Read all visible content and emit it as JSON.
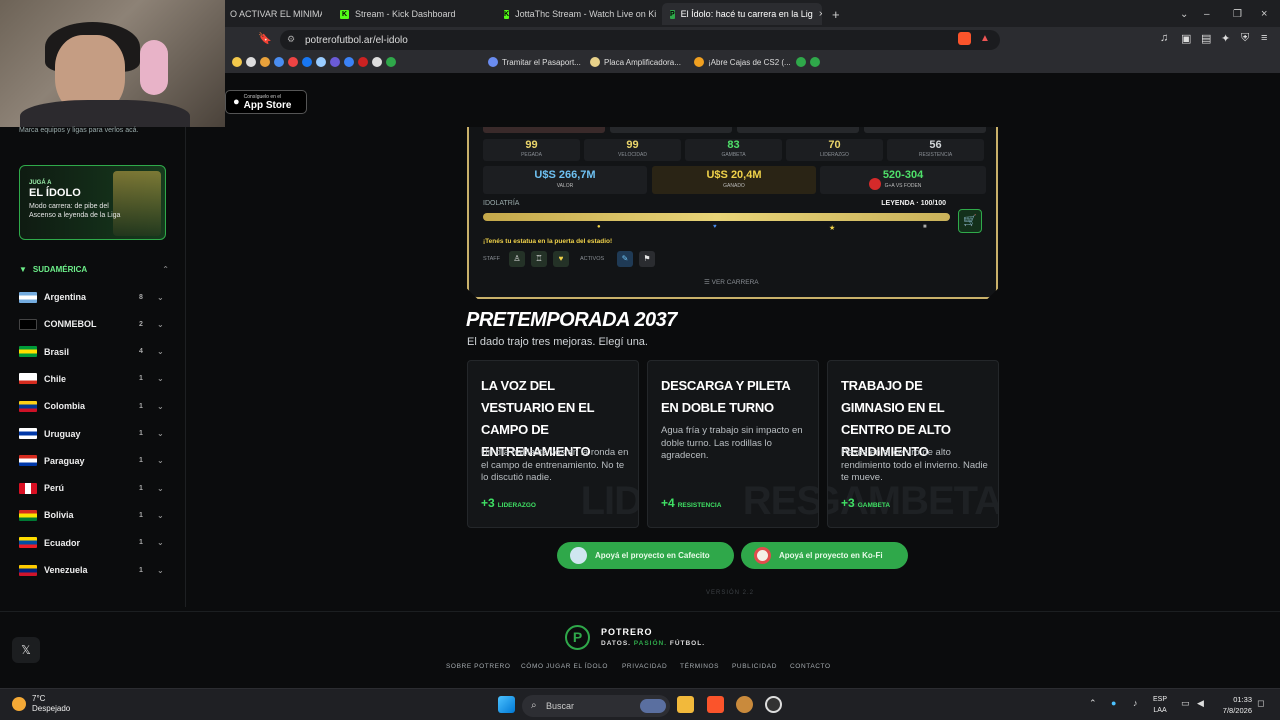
{
  "browser": {
    "tabs": [
      {
        "label": "O ACTIVAR EL MINIMAPA"
      },
      {
        "label": "Stream - Kick Dashboard"
      },
      {
        "label": "JottaThc Stream - Watch Live on Kick"
      },
      {
        "label": "El Ídolo: hacé tu carrera en la Lig"
      }
    ],
    "new_tab": "+",
    "url": "potrerofutbol.ar/el-idolo",
    "bookmarks": [
      "Tramitar el Pasaport...",
      "Placa Amplificadora...",
      "¡Abre Cajas de CS2 (..."
    ]
  },
  "appstore": {
    "small": "Consíguelo en el",
    "big": "App Store"
  },
  "sidebar": {
    "hint": "Marca equipos y ligas para verlos acá.",
    "promo": {
      "kicker": "JUGÁ A",
      "title": "EL ÍDOLO",
      "desc": "Modo carrera: de pibe del Ascenso a leyenda de la Liga"
    },
    "region": "SUDAMÉRICA",
    "countries": [
      {
        "name": "Argentina",
        "count": "8"
      },
      {
        "name": "CONMEBOL",
        "count": "2"
      },
      {
        "name": "Brasil",
        "count": "4"
      },
      {
        "name": "Chile",
        "count": "1"
      },
      {
        "name": "Colombia",
        "count": "1"
      },
      {
        "name": "Uruguay",
        "count": "1"
      },
      {
        "name": "Paraguay",
        "count": "1"
      },
      {
        "name": "Perú",
        "count": "1"
      },
      {
        "name": "Bolivia",
        "count": "1"
      },
      {
        "name": "Ecuador",
        "count": "1"
      },
      {
        "name": "Venezuela",
        "count": "1"
      }
    ]
  },
  "card": {
    "stats": [
      {
        "value": "99",
        "label": "PEGADA"
      },
      {
        "value": "99",
        "label": "VELOCIDAD"
      },
      {
        "value": "83",
        "label": "GAMBETA"
      },
      {
        "value": "70",
        "label": "LIDERAZGO"
      },
      {
        "value": "56",
        "label": "RESISTENCIA"
      }
    ],
    "valor": {
      "value": "U$S 266,7M",
      "label": "VALOR"
    },
    "ganado": {
      "value": "U$S 20,4M",
      "label": "GANADO"
    },
    "record": {
      "value": "520-304",
      "label": "G+A VS FODEN"
    },
    "idolatria_label": "IDOLATRÍA",
    "legend": "LEYENDA · 100/100",
    "idolatria_level": 1.0,
    "estatua": "¡Tenés tu estatua en la puerta del estadio!",
    "staff_label": "STAFF",
    "activos_label": "ACTIVOS",
    "ver_carrera": "VER CARRERA"
  },
  "pretemporada": {
    "title": "PRETEMPORADA 2037",
    "subtitle": "El dado trajo tres mejoras. Elegí una.",
    "options": [
      {
        "title": "LA VOZ DEL VESTUARIO EN EL CAMPO DE ENTRENAMIENTO",
        "desc": "Un día hablaste vos en la ronda en el campo de entrenamiento. No te lo discutió nadie.",
        "bonus": "+3",
        "stat": "LIDERAZGO",
        "wm": "LID"
      },
      {
        "title": "DESCARGA Y PILETA EN DOBLE TURNO",
        "desc": "Agua fría y trabajo sin impacto en doble turno. Las rodillas lo agradecen.",
        "bonus": "+4",
        "stat": "RESISTENCIA",
        "wm": "RES"
      },
      {
        "title": "TRABAJO DE GIMNASIO EN EL CENTRO DE ALTO RENDIMIENTO",
        "desc": "Pesas en el centro de alto rendimiento todo el invierno. Nadie te mueve.",
        "bonus": "+3",
        "stat": "GAMBETA",
        "wm": "GAMBETA"
      }
    ]
  },
  "donate": {
    "cafecito": "Apoyá el proyecto en Cafecito",
    "kofi": "Apoyá el proyecto en Ko-Fi"
  },
  "version": "VERSIÓN 2.2",
  "footer": {
    "logo": "P",
    "name": "POTRERO",
    "tag1": "DATOS.",
    "tag2": "PASIÓN.",
    "tag3": "FÚTBOL.",
    "links": [
      "SOBRE POTRERO",
      "CÓMO JUGAR EL ÍDOLO",
      "PRIVACIDAD",
      "TÉRMINOS",
      "PUBLICIDAD",
      "CONTACTO"
    ]
  },
  "taskbar": {
    "temp": "7°C",
    "weather": "Despejado",
    "search": "Buscar",
    "lang1": "ESP",
    "lang2": "LAA",
    "time": "01:33",
    "date": "7/8/2026"
  },
  "colors": {
    "accent": "#2fa84a",
    "gold": "#c9b16a",
    "stat_yellow": "#e9d46a"
  }
}
